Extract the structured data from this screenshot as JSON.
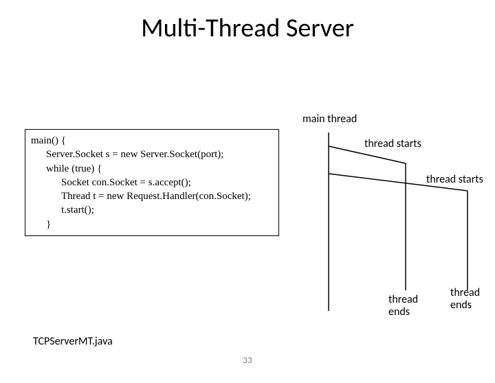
{
  "title": "Multi-Thread Server",
  "code": {
    "l1": "main() {",
    "l2": "Server.Socket s = new Server.Socket(port);",
    "l3": "while (true) {",
    "l4": "Socket con.Socket = s.accept();",
    "l5": "Thread t =  new Request.Handler(con.Socket);",
    "l6": "t.start();",
    "l7": "}"
  },
  "diagram": {
    "main_thread": "main thread",
    "thread_starts_1": "thread starts",
    "thread_starts_2": "thread starts",
    "thread_ends_1": "thread\nends",
    "thread_ends_2": "thread\nends"
  },
  "footnote": "TCPServerMT.java",
  "page_number": "33"
}
